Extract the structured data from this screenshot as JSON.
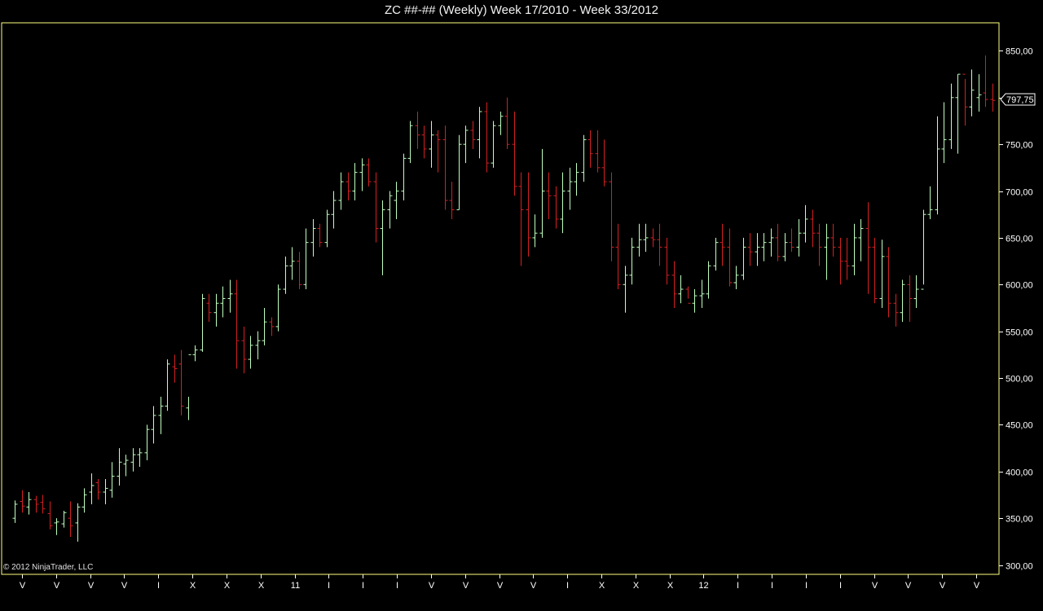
{
  "chart_title": "ZC ##-## (Weekly)  Week 17/2010 - Week 33/2012",
  "copyright": "© 2012 NinjaTrader, LLC",
  "colors": {
    "background": "#000000",
    "border": "#ffff80",
    "up": "#bfffbf",
    "down": "#d32020",
    "text": "#ffffff"
  },
  "chart_data": {
    "type": "ohlc",
    "title": "ZC ##-## (Weekly)  Week 17/2010 - Week 33/2012",
    "ylim": [
      290,
      880
    ],
    "y_ticks": [
      "300,00",
      "350,00",
      "400,00",
      "450,00",
      "500,00",
      "550,00",
      "600,00",
      "650,00",
      "700,00",
      "750,00",
      "800,00",
      "850,00"
    ],
    "last_price": "797,75",
    "x_ticks": [
      "V",
      "V",
      "V",
      "V",
      "I",
      "X",
      "X",
      "X",
      "11",
      "I",
      "I",
      "I",
      "V",
      "V",
      "V",
      "V",
      "I",
      "X",
      "X",
      "X",
      "12",
      "I",
      "I",
      "I",
      "I",
      "V",
      "V",
      "V",
      "V"
    ],
    "bars": [
      [
        350,
        369,
        345,
        365
      ],
      [
        368,
        380,
        356,
        363
      ],
      [
        362,
        378,
        354,
        370
      ],
      [
        370,
        374,
        356,
        365
      ],
      [
        367,
        375,
        355,
        360
      ],
      [
        355,
        368,
        338,
        342
      ],
      [
        345,
        350,
        332,
        346
      ],
      [
        344,
        358,
        340,
        356
      ],
      [
        350,
        368,
        330,
        342
      ],
      [
        345,
        366,
        325,
        362
      ],
      [
        362,
        382,
        356,
        375
      ],
      [
        378,
        398,
        365,
        385
      ],
      [
        388,
        392,
        370,
        378
      ],
      [
        378,
        392,
        365,
        382
      ],
      [
        380,
        410,
        372,
        395
      ],
      [
        395,
        425,
        385,
        410
      ],
      [
        408,
        418,
        395,
        412
      ],
      [
        410,
        425,
        400,
        418
      ],
      [
        418,
        425,
        405,
        420
      ],
      [
        420,
        450,
        412,
        445
      ],
      [
        445,
        470,
        430,
        460
      ],
      [
        460,
        480,
        440,
        470
      ],
      [
        470,
        520,
        465,
        515
      ],
      [
        512,
        525,
        495,
        510
      ],
      [
        515,
        530,
        460,
        470
      ],
      [
        468,
        480,
        455,
        525
      ],
      [
        525,
        535,
        518,
        530
      ],
      [
        530,
        590,
        528,
        585
      ],
      [
        580,
        590,
        560,
        570
      ],
      [
        570,
        590,
        555,
        580
      ],
      [
        580,
        598,
        565,
        585
      ],
      [
        585,
        605,
        570,
        590
      ],
      [
        590,
        605,
        510,
        540
      ],
      [
        540,
        555,
        505,
        520
      ],
      [
        520,
        545,
        510,
        535
      ],
      [
        535,
        550,
        520,
        540
      ],
      [
        540,
        575,
        535,
        560
      ],
      [
        560,
        565,
        545,
        555
      ],
      [
        555,
        600,
        550,
        595
      ],
      [
        595,
        630,
        590,
        620
      ],
      [
        620,
        640,
        605,
        625
      ],
      [
        625,
        635,
        595,
        600
      ],
      [
        600,
        660,
        595,
        645
      ],
      [
        645,
        670,
        630,
        660
      ],
      [
        660,
        665,
        640,
        645
      ],
      [
        645,
        680,
        640,
        675
      ],
      [
        675,
        700,
        660,
        690
      ],
      [
        690,
        720,
        680,
        710
      ],
      [
        710,
        720,
        690,
        700
      ],
      [
        700,
        730,
        690,
        720
      ],
      [
        720,
        735,
        700,
        728
      ],
      [
        728,
        735,
        705,
        710
      ],
      [
        710,
        720,
        645,
        660
      ],
      [
        660,
        690,
        610,
        680
      ],
      [
        680,
        700,
        660,
        695
      ],
      [
        690,
        710,
        670,
        700
      ],
      [
        700,
        740,
        690,
        735
      ],
      [
        735,
        775,
        730,
        770
      ],
      [
        770,
        785,
        745,
        760
      ],
      [
        760,
        770,
        735,
        745
      ],
      [
        745,
        775,
        725,
        760
      ],
      [
        760,
        765,
        720,
        755
      ],
      [
        755,
        770,
        680,
        690
      ],
      [
        690,
        710,
        670,
        680
      ],
      [
        680,
        760,
        680,
        750
      ],
      [
        750,
        770,
        730,
        765
      ],
      [
        765,
        775,
        745,
        755
      ],
      [
        755,
        790,
        735,
        785
      ],
      [
        785,
        795,
        720,
        730
      ],
      [
        730,
        775,
        725,
        770
      ],
      [
        770,
        785,
        760,
        780
      ],
      [
        780,
        800,
        745,
        750
      ],
      [
        750,
        785,
        695,
        705
      ],
      [
        705,
        720,
        620,
        680
      ],
      [
        680,
        720,
        630,
        650
      ],
      [
        650,
        675,
        640,
        655
      ],
      [
        655,
        745,
        650,
        700
      ],
      [
        700,
        720,
        670,
        695
      ],
      [
        695,
        705,
        660,
        670
      ],
      [
        670,
        720,
        655,
        700
      ],
      [
        700,
        725,
        680,
        710
      ],
      [
        710,
        730,
        695,
        720
      ],
      [
        720,
        760,
        710,
        755
      ],
      [
        755,
        765,
        725,
        740
      ],
      [
        740,
        765,
        720,
        725
      ],
      [
        725,
        755,
        705,
        710
      ],
      [
        710,
        720,
        625,
        640
      ],
      [
        640,
        665,
        595,
        600
      ],
      [
        600,
        620,
        570,
        610
      ],
      [
        610,
        650,
        600,
        640
      ],
      [
        640,
        665,
        630,
        648
      ],
      [
        648,
        665,
        635,
        650
      ],
      [
        650,
        660,
        640,
        648
      ],
      [
        648,
        665,
        620,
        640
      ],
      [
        640,
        650,
        600,
        610
      ],
      [
        610,
        625,
        575,
        590
      ],
      [
        590,
        610,
        580,
        595
      ],
      [
        595,
        598,
        585,
        580
      ],
      [
        580,
        595,
        570,
        588
      ],
      [
        588,
        605,
        575,
        590
      ],
      [
        590,
        625,
        585,
        620
      ],
      [
        620,
        650,
        615,
        645
      ],
      [
        645,
        665,
        620,
        640
      ],
      [
        640,
        660,
        598,
        602
      ],
      [
        602,
        620,
        595,
        610
      ],
      [
        610,
        650,
        605,
        640
      ],
      [
        640,
        655,
        620,
        635
      ],
      [
        635,
        655,
        620,
        640
      ],
      [
        640,
        655,
        625,
        645
      ],
      [
        645,
        660,
        630,
        650
      ],
      [
        650,
        665,
        625,
        630
      ],
      [
        630,
        655,
        625,
        645
      ],
      [
        645,
        660,
        635,
        640
      ],
      [
        640,
        670,
        630,
        655
      ],
      [
        655,
        685,
        645,
        670
      ],
      [
        670,
        680,
        640,
        655
      ],
      [
        655,
        665,
        620,
        640
      ],
      [
        640,
        665,
        605,
        650
      ],
      [
        650,
        665,
        630,
        640
      ],
      [
        640,
        650,
        600,
        625
      ],
      [
        625,
        650,
        605,
        620
      ],
      [
        620,
        665,
        610,
        650
      ],
      [
        650,
        670,
        625,
        660
      ],
      [
        660,
        688,
        590,
        640
      ],
      [
        640,
        650,
        580,
        585
      ],
      [
        585,
        648,
        575,
        630
      ],
      [
        630,
        640,
        565,
        580
      ],
      [
        580,
        590,
        555,
        570
      ],
      [
        570,
        605,
        560,
        600
      ],
      [
        600,
        610,
        560,
        585
      ],
      [
        585,
        610,
        575,
        595
      ],
      [
        595,
        680,
        600,
        675
      ],
      [
        675,
        705,
        670,
        680
      ],
      [
        680,
        780,
        675,
        745
      ],
      [
        745,
        795,
        730,
        755
      ],
      [
        755,
        815,
        745,
        800
      ],
      [
        800,
        825,
        740,
        825
      ],
      [
        825,
        820,
        770,
        790
      ],
      [
        790,
        830,
        780,
        808
      ],
      [
        800,
        825,
        785,
        803
      ],
      [
        805,
        845,
        790,
        798
      ],
      [
        798,
        815,
        785,
        797
      ]
    ]
  }
}
